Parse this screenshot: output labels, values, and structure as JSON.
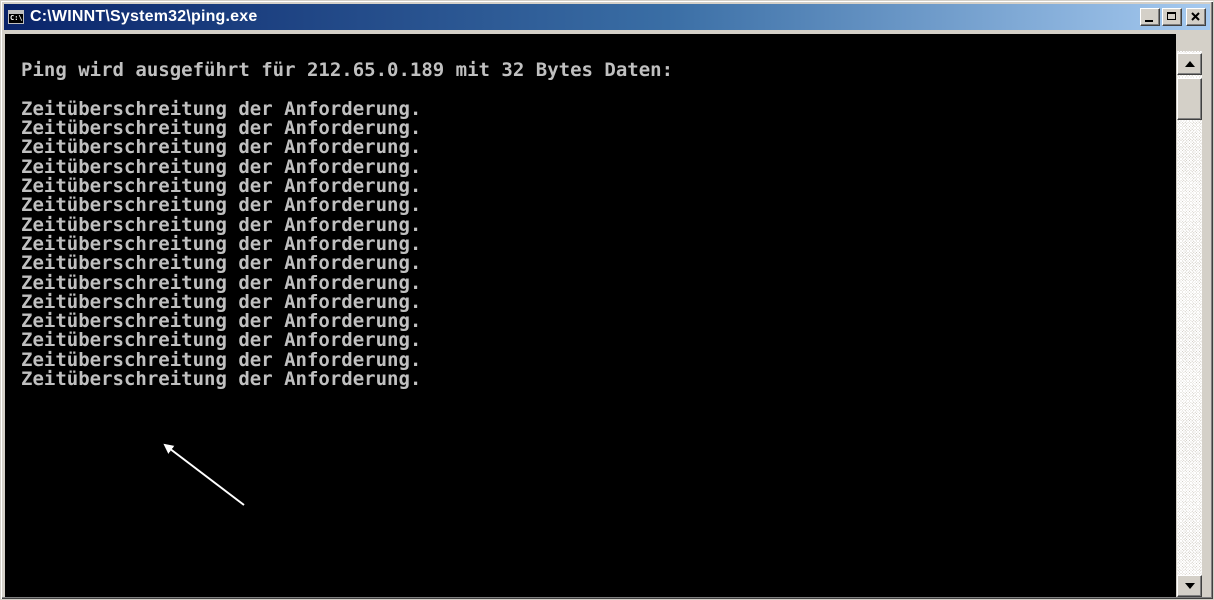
{
  "window": {
    "title": "C:\\WINNT\\System32\\ping.exe",
    "icon": "console-icon"
  },
  "title_buttons": {
    "minimize_icon": "minimize-icon",
    "maximize_icon": "maximize-icon",
    "close_icon": "close-icon"
  },
  "console": {
    "text_color": "#c0c0c0",
    "background": "#000000",
    "lines": [
      "",
      "Ping wird ausgeführt für 212.65.0.189 mit 32 Bytes Daten:",
      "",
      "Zeitüberschreitung der Anforderung.",
      "Zeitüberschreitung der Anforderung.",
      "Zeitüberschreitung der Anforderung.",
      "Zeitüberschreitung der Anforderung.",
      "Zeitüberschreitung der Anforderung.",
      "Zeitüberschreitung der Anforderung.",
      "Zeitüberschreitung der Anforderung.",
      "Zeitüberschreitung der Anforderung.",
      "Zeitüberschreitung der Anforderung.",
      "Zeitüberschreitung der Anforderung.",
      "Zeitüberschreitung der Anforderung.",
      "Zeitüberschreitung der Anforderung.",
      "Zeitüberschreitung der Anforderung.",
      "Zeitüberschreitung der Anforderung.",
      "Zeitüberschreitung der Anforderung."
    ]
  },
  "annotation": {
    "arrow_color": "#ffffff"
  },
  "scrollbar": {
    "up_icon": "scroll-up-arrow-icon",
    "down_icon": "scroll-down-arrow-icon"
  },
  "colors": {
    "title_gradient_start": "#0a246a",
    "title_gradient_end": "#a6caf0",
    "chrome": "#d4d0c8"
  }
}
